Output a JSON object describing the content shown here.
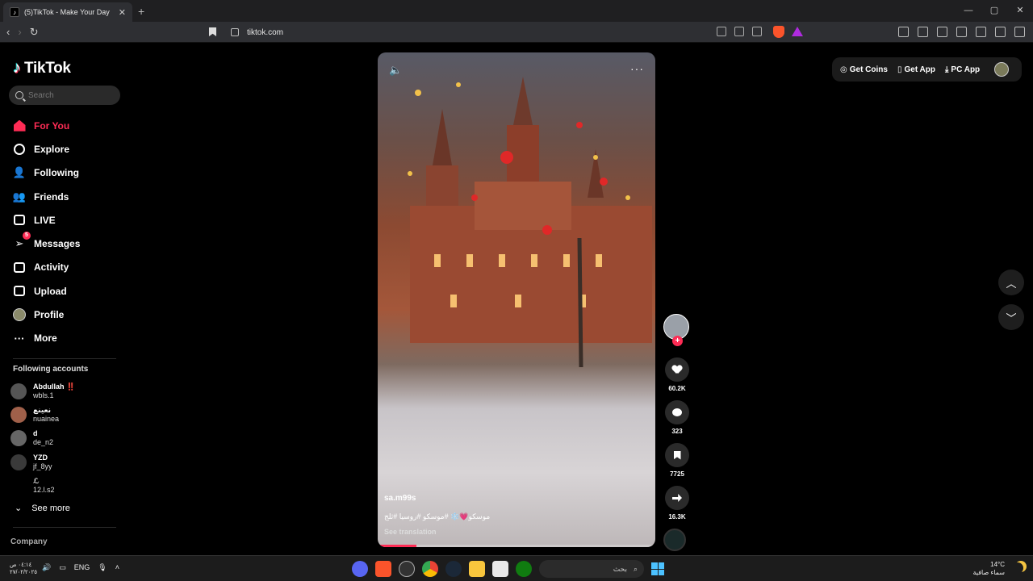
{
  "browser": {
    "tab_title": "(5)TikTok - Make Your Day",
    "url": "tiktok.com"
  },
  "sidebar": {
    "logo_text": "TikTok",
    "search_placeholder": "Search",
    "menu": [
      {
        "label": "For You",
        "icon": "home-icon",
        "active": true
      },
      {
        "label": "Explore",
        "icon": "compass-icon"
      },
      {
        "label": "Following",
        "icon": "following-icon"
      },
      {
        "label": "Friends",
        "icon": "friends-icon"
      },
      {
        "label": "LIVE",
        "icon": "live-icon"
      },
      {
        "label": "Messages",
        "icon": "messages-icon",
        "badge": "5"
      },
      {
        "label": "Activity",
        "icon": "activity-icon"
      },
      {
        "label": "Upload",
        "icon": "upload-icon"
      },
      {
        "label": "Profile",
        "icon": "profile-icon"
      },
      {
        "label": "More",
        "icon": "more-icon"
      }
    ],
    "following_title": "Following accounts",
    "following": [
      {
        "name": "Abdullah ‼️",
        "handle": "wbls.1"
      },
      {
        "name": "نعينع",
        "handle": "nuainea"
      },
      {
        "name": "d",
        "handle": "de_n2"
      },
      {
        "name": "YZD",
        "handle": "jf_8yy"
      },
      {
        "name": "ℒ",
        "handle": "12.l.s2"
      }
    ],
    "see_more": "See more",
    "company": "Company"
  },
  "topbar": {
    "get_coins": "Get Coins",
    "get_app": "Get App",
    "pc_app": "PC App"
  },
  "video": {
    "author": "sa.m99s",
    "caption": "موسكو💗❄️ #موسكو #روسيا #ثلج",
    "see_translation": "See translation",
    "progress": 0.14
  },
  "actions": {
    "likes": "60.2K",
    "comments": "323",
    "saves": "7725",
    "shares": "16.3K"
  },
  "taskbar": {
    "time": "٠٤:١٤ ص",
    "date": "٢٧/٠٢/٢٠٢٥",
    "lang": "ENG",
    "search": "بحث",
    "temp": "14°C",
    "weather": "سماء صافية"
  },
  "colors": {
    "accent": "#fe2c55",
    "bg": "#000000"
  }
}
